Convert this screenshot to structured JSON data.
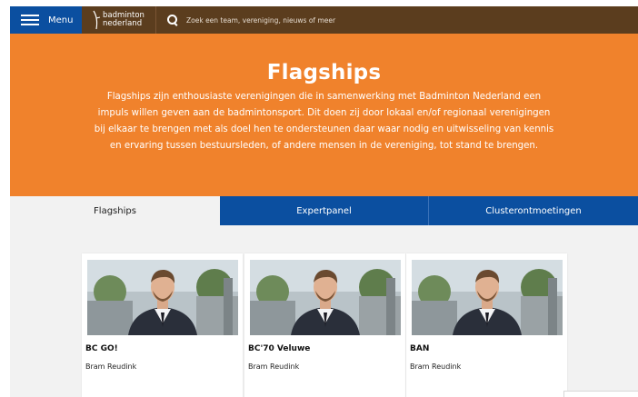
{
  "nav": {
    "menu_label": "Menu",
    "logo_line1": "badminton",
    "logo_line2": "nederland",
    "search_placeholder": "Zoek een team, vereniging, nieuws of meer",
    "menu_icon": "hamburger-icon",
    "search_icon": "search-icon"
  },
  "hero": {
    "title": "Flagships",
    "text": "Flagships zijn enthousiaste verenigingen die in samenwerking met Badminton Nederland een impuls willen geven aan de badmintonsport. Dit doen zij door lokaal en/of regionaal verenigingen bij elkaar te brengen met als doel hen te ondersteunen daar waar nodig en uitwisseling van kennis en ervaring tussen bestuursleden, of andere mensen in de vereniging, tot stand te brengen."
  },
  "tabs": [
    {
      "label": "Flagships",
      "active": true
    },
    {
      "label": "Expertpanel",
      "active": false
    },
    {
      "label": "Clusterontmoetingen",
      "active": false
    }
  ],
  "cards": [
    {
      "title": "BC GO!",
      "subtitle": "Bram Reudink"
    },
    {
      "title": "BC'70 Veluwe",
      "subtitle": "Bram Reudink"
    },
    {
      "title": "BAN",
      "subtitle": "Bram Reudink"
    }
  ],
  "colors": {
    "nav_brown": "#5b3d1e",
    "brand_blue": "#0b4fa0",
    "hero_orange": "#f0822c",
    "content_bg": "#f2f2f2"
  }
}
